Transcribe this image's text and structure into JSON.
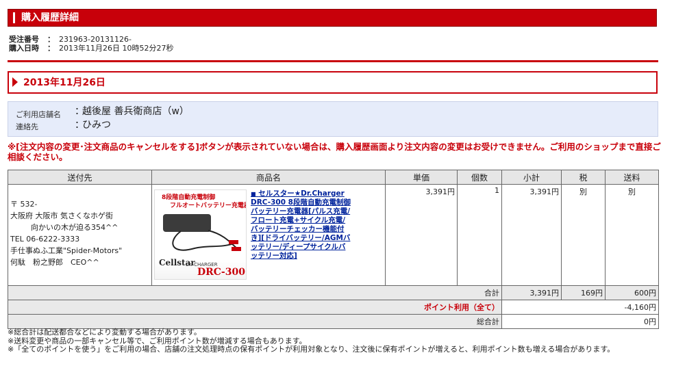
{
  "header": {
    "title": "購入履歴詳細"
  },
  "order": {
    "number_label": "受注番号",
    "number_value": "231963-20131126-",
    "date_label": "購入日時",
    "date_value": "2013年11月26日 10時52分27秒",
    "colon": "："
  },
  "date_bar": {
    "date": "2013年11月26日"
  },
  "shop": {
    "name_label": "ご利用店舗名",
    "name_value": "越後屋 善兵衛商店（w）",
    "contact_label": "連絡先",
    "contact_value": "ひみつ",
    "colon": "："
  },
  "warning": "※[注文内容の変更･注文商品のキャンセルをする]ボタンが表示されていない場合は、購入履歴画面より注文内容の変更はお受けできません。ご利用のショップまで直接ご相談ください。",
  "table": {
    "headers": [
      "送付先",
      "商品名",
      "単価",
      "個数",
      "小計",
      "税",
      "送料"
    ],
    "shipping": {
      "postal": "〒 532-",
      "address1": "大阪府 大阪市 気さくなホゲ街",
      "address2": "向かいの木が迫る354^^",
      "tel": "TEL 06-6222-3333",
      "company": "手仕事ぬふ工業\"Spider-Motors\"",
      "person": "何駄　粉之野郎　CEO^^"
    },
    "product": {
      "name": "セルスター★Dr.Charger DRC-300 8段階自動充電制御バッテリー充電器[パルス充電/フロート充電+サイクル充電/バッテリーチェッカー機能付き][ドライバッテリー/AGMバッテリー/ディープサイクルバッテリー対応]",
      "image_text1": "8段階自動充電制御",
      "image_text2": "フルオートバッテリー充電器",
      "image_brand": "Cellstar",
      "image_sub": "Dr. CHARGER",
      "image_model": "DRC-300"
    },
    "unit_price": "3,391円",
    "quantity": "1",
    "subtotal": "3,391円",
    "tax": "別",
    "shipping_fee": "別",
    "total_label": "合計",
    "total_subtotal": "3,391円",
    "total_tax": "169円",
    "total_shipping": "600円",
    "points_label": "ポイント利用（全て）",
    "points_value": "-4,160円",
    "grand_total_label": "総合計",
    "grand_total_value": "0円"
  },
  "notes": [
    "※総合計は配送都合などにより変動する場合があります。",
    "※送料変更や商品の一部キャンセル等で、ご利用ポイント数が増減する場合もあります。",
    "※「全てのポイントを使う」をご利用の場合、店舗の注文処理時点の保有ポイントが利用対象となり、注文後に保有ポイントが増えると、利用ポイント数も増える場合があります。"
  ]
}
